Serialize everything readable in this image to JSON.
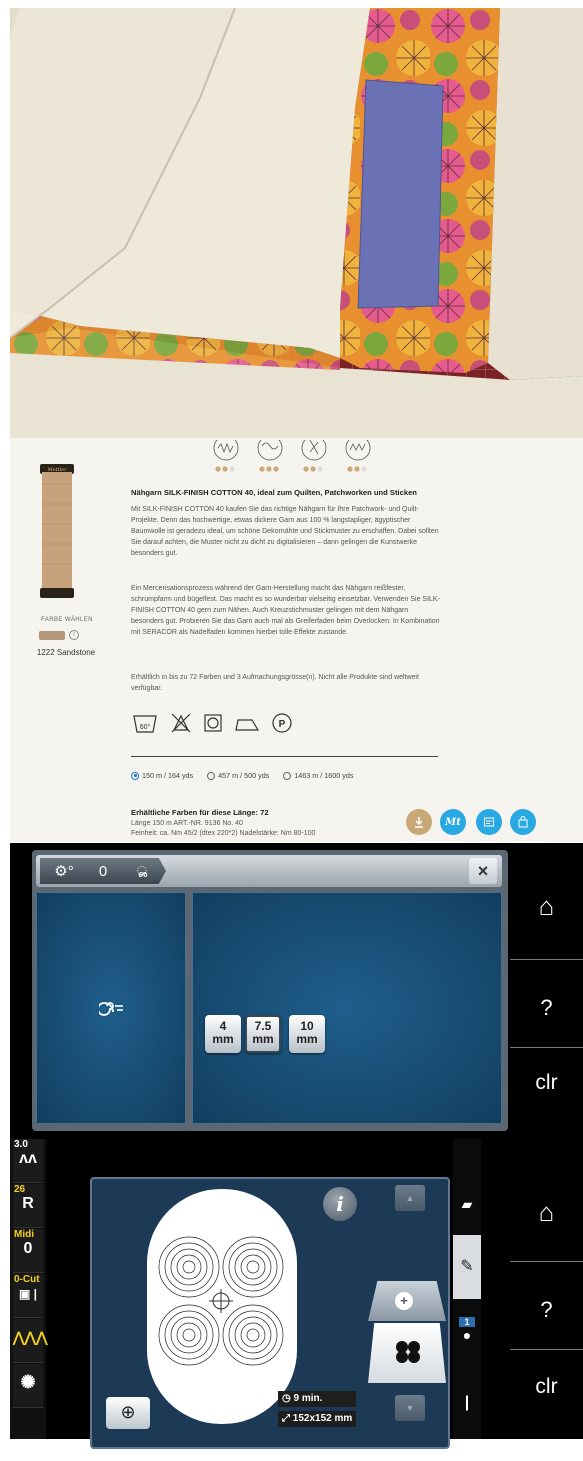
{
  "product": {
    "title": "Nähgarn SILK-FINISH COTTON 40, ideal zum Quilten, Patchworken und Sticken",
    "paragraph1": "Mit SILK-FINISH COTTON 40 kaufen Sie das richtige Nähgarn für Ihre Patchwork- und Quilt-Projekte. Denn das hochwertige, etwas dickere Garn aus 100 % langstapliger, ägyptischer Baumwolle ist geradezu ideal, um schöne Dekornähte und Stickmuster zu erschaffen. Dabei sollten Sie darauf achten, die Muster nicht zu dicht zu digitalisieren – dann gelingen die Kunstwerke besonders gut.",
    "paragraph2": "Ein Mercerisationsprozess während der Garn-Herstellung macht das Nähgarn reißfester, schrumpfarm und bügelfest. Das macht es so wunderbar vielseitig einsetzbar. Verwenden Sie SILK-FINISH COTTON 40 gern zum Nähen. Auch Kreuzstichmuster gelingen mit dem Nähgarn besonders gut. Probieren Sie das Garn auch mal als Greiferfaden beim Overlocken: In Kombination mit SERACOR als Nadelfaden kommen hierbei tolle Effekte zustande.",
    "paragraph3": "Erhältlich in bis zu 72 Farben und 3 Aufmachungsgrösse(n). Nicht alle Produkte sind weltweit verfügbar.",
    "color_label": "FARBE WÄHLEN",
    "color_name": "1222 Sandstone",
    "spool_brand": "Mettler",
    "wash_temp": "60°",
    "care_p": "P",
    "sizes": [
      {
        "label": "150 m / 164 yds",
        "selected": true
      },
      {
        "label": "457 m / 500 yds",
        "selected": false
      },
      {
        "label": "1463 m / 1600 yds",
        "selected": false
      }
    ],
    "avail_title": "Erhältliche Farben für diese Länge: 72",
    "avail_line1": "Länge 150 m ART.-NR. 9136 No. 40",
    "avail_line2": "Feinheit: ca. Nm 45/2 (dtex 220*2) Nadelstärke: Nm 80-100",
    "buttons": [
      {
        "icon": "download-icon",
        "color": "#c9a878"
      },
      {
        "icon": "mettler-logo-icon",
        "color": "#29a9e1"
      },
      {
        "icon": "note-icon",
        "color": "#29a9e1"
      },
      {
        "icon": "shop-icon",
        "color": "#29a9e1"
      }
    ]
  },
  "screen1": {
    "mm_buttons": [
      {
        "value": "4",
        "unit": "mm",
        "selected": false
      },
      {
        "value": "7.5",
        "unit": "mm",
        "selected": true
      },
      {
        "value": "10",
        "unit": "mm",
        "selected": false
      }
    ],
    "side": {
      "home": "⌂",
      "help": "?",
      "clr": "clr"
    }
  },
  "screen2": {
    "left": [
      {
        "num": "3.0",
        "icon": "stitch-length-icon"
      },
      {
        "num": "26",
        "icon": "presser-foot-icon"
      },
      {
        "num": "Midi",
        "icon": "hoop-icon"
      },
      {
        "num": "0-Cut",
        "icon": "needle-cut-icon"
      },
      {
        "num": "",
        "icon": "zigzag-icon"
      },
      {
        "num": "",
        "icon": "bobbin-icon"
      }
    ],
    "time": "9 min.",
    "size": "152x152 mm",
    "color_count": "1",
    "side": {
      "home": "⌂",
      "help": "?",
      "clr": "clr"
    }
  }
}
